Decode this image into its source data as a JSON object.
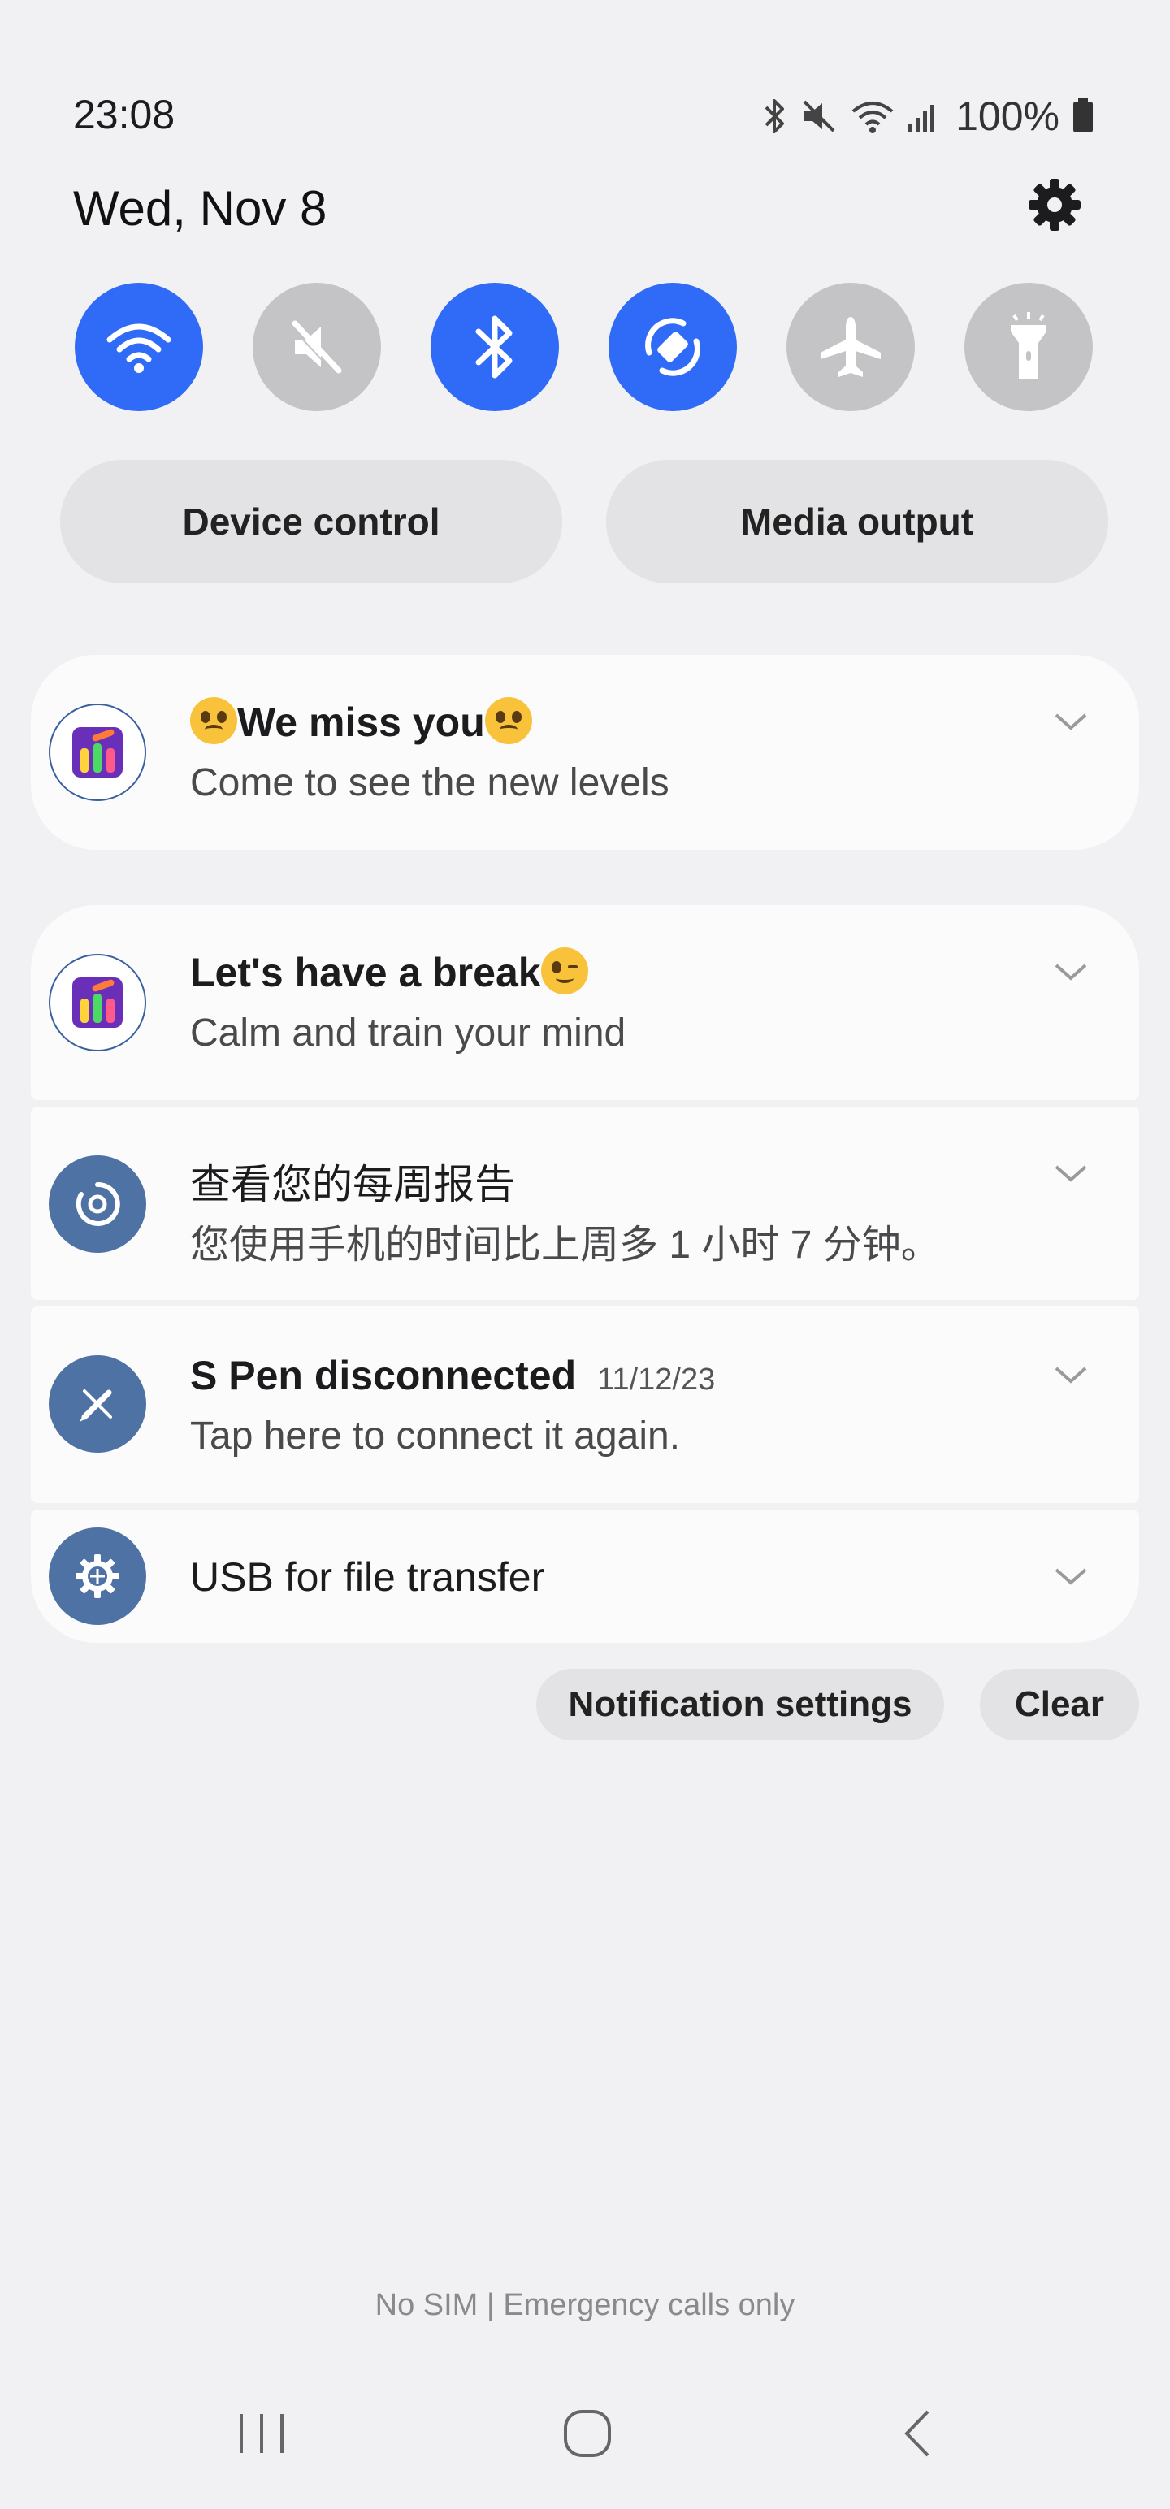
{
  "status_bar": {
    "time": "23:08",
    "battery": "100%",
    "icons": [
      "bluetooth-icon",
      "mute-icon",
      "wifi-icon",
      "signal-icon",
      "battery-icon"
    ]
  },
  "header": {
    "date": "Wed, Nov 8",
    "settings_icon": "gear-icon"
  },
  "quick_toggles": [
    {
      "name": "wifi",
      "icon": "wifi-icon",
      "state": "on"
    },
    {
      "name": "sound",
      "icon": "mute-icon",
      "state": "off"
    },
    {
      "name": "bluetooth",
      "icon": "bluetooth-icon",
      "state": "on"
    },
    {
      "name": "auto-rotate",
      "icon": "rotate-icon",
      "state": "on"
    },
    {
      "name": "airplane-mode",
      "icon": "airplane-icon",
      "state": "off"
    },
    {
      "name": "flashlight",
      "icon": "flashlight-icon",
      "state": "off"
    }
  ],
  "buttons": {
    "device_control": "Device control",
    "media_output": "Media output"
  },
  "notifications": [
    {
      "title": "We miss you",
      "body": "Come to see the new levels",
      "icon": "sort-puzzle-app-icon"
    },
    {
      "title": "Let's have a break",
      "body": "Calm and train your mind",
      "icon": "sort-puzzle-app-icon"
    },
    {
      "title": "查看您的每周报告",
      "body": "您使用手机的时间比上周多 1 小时 7 分钟。",
      "icon": "digital-wellbeing-icon"
    },
    {
      "title": "S Pen disconnected",
      "date": "11/12/23",
      "body": "Tap here to connect it again.",
      "icon": "s-pen-icon"
    },
    {
      "title": "USB for file transfer",
      "icon": "usb-settings-icon"
    }
  ],
  "actions": {
    "notification_settings": "Notification settings",
    "clear": "Clear"
  },
  "footer": {
    "carrier": "No SIM | Emergency calls only"
  },
  "colors": {
    "accent": "#2f6bf7",
    "toggle_off": "#c4c4c6",
    "system_icon": "#4f72a4"
  }
}
